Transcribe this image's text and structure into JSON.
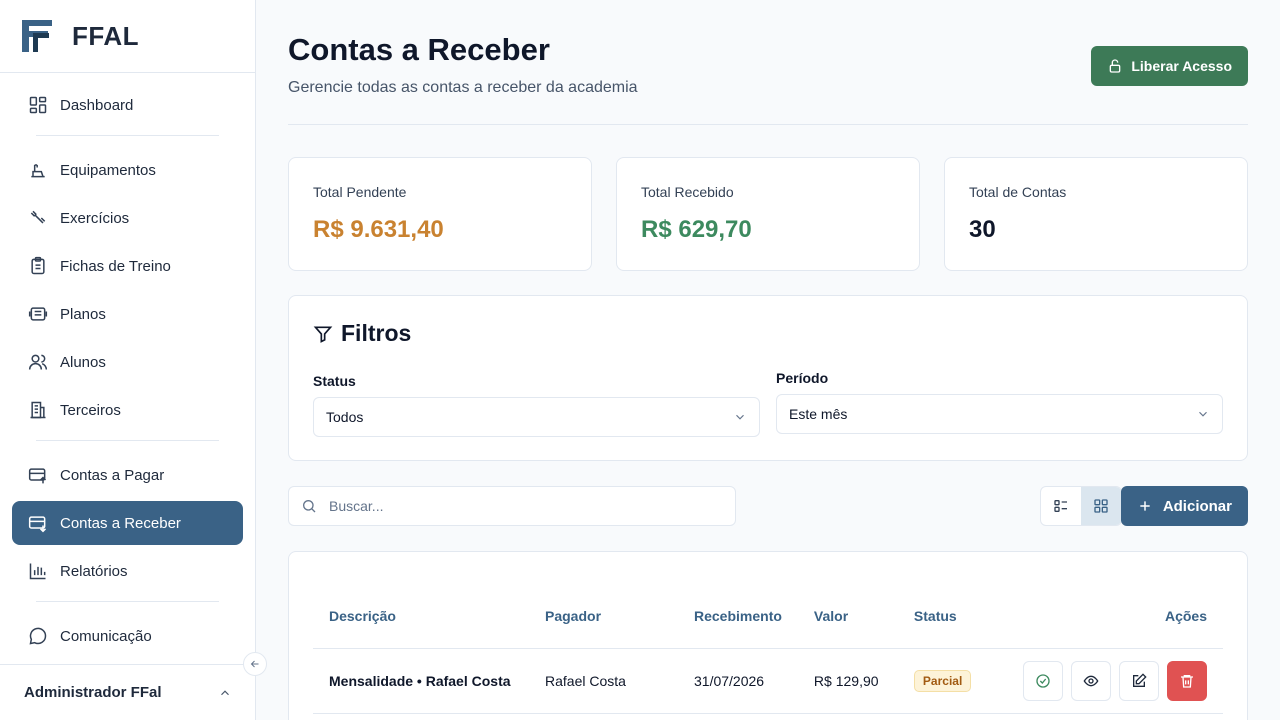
{
  "brand": {
    "name": "FFAL",
    "logo_icon": "ffal-logo-icon"
  },
  "sidebar": {
    "items": [
      {
        "label": "Dashboard",
        "icon": "dashboard-icon"
      },
      {
        "label": "Equipamentos",
        "icon": "equipment-icon"
      },
      {
        "label": "Exercícios",
        "icon": "exercise-icon"
      },
      {
        "label": "Fichas de Treino",
        "icon": "clipboard-icon"
      },
      {
        "label": "Planos",
        "icon": "plans-icon"
      },
      {
        "label": "Alunos",
        "icon": "users-icon"
      },
      {
        "label": "Terceiros",
        "icon": "building-icon"
      },
      {
        "label": "Contas a Pagar",
        "icon": "payable-icon"
      },
      {
        "label": "Contas a Receber",
        "icon": "receivable-icon",
        "active": true
      },
      {
        "label": "Relatórios",
        "icon": "chart-icon"
      },
      {
        "label": "Comunicação",
        "icon": "chat-icon"
      }
    ],
    "footer_user": "Administrador FFal"
  },
  "header": {
    "title": "Contas a Receber",
    "subtitle": "Gerencie todas as contas a receber da academia",
    "release_button": "Liberar Acesso"
  },
  "stats": [
    {
      "label": "Total Pendente",
      "value": "R$ 9.631,40",
      "color": "#c98230"
    },
    {
      "label": "Total Recebido",
      "value": "R$ 629,70",
      "color": "#3d8a5f"
    },
    {
      "label": "Total de Contas",
      "value": "30",
      "color": "#0f172a"
    }
  ],
  "filters": {
    "title": "Filtros",
    "status_label": "Status",
    "status_value": "Todos",
    "period_label": "Período",
    "period_value": "Este mês"
  },
  "toolbar": {
    "search_placeholder": "Buscar...",
    "add_button": "Adicionar"
  },
  "table": {
    "columns": [
      "Descrição",
      "Pagador",
      "Recebimento",
      "Valor",
      "Status",
      "Ações"
    ],
    "rows": [
      {
        "descricao": "Mensalidade • Rafael Costa",
        "pagador": "Rafael Costa",
        "recebimento": "31/07/2026",
        "valor": "R$ 129,90",
        "status": "Parcial"
      }
    ]
  },
  "colors": {
    "primary": "#3a6286",
    "success": "#3d7a57",
    "danger": "#e05252"
  }
}
